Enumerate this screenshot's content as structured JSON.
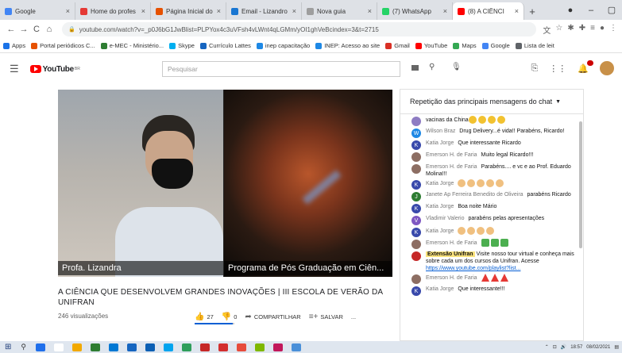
{
  "browser": {
    "tabs": [
      {
        "title": "Google",
        "favicon_color": "#4285f4"
      },
      {
        "title": "Home do profes",
        "favicon_color": "#e53935"
      },
      {
        "title": "Página Inicial do",
        "favicon_color": "#e65100"
      },
      {
        "title": "Email - Lizandro",
        "favicon_color": "#1976d2"
      },
      {
        "title": "Nova guia",
        "favicon_color": "#9e9e9e"
      },
      {
        "title": "(7) WhatsApp",
        "favicon_color": "#25d366"
      },
      {
        "title": "(8) A CIÊNCI",
        "favicon_color": "#ff0000"
      }
    ],
    "url": "youtube.com/watch?v=_p0J6bG1JwBlist=PLPYox4c3uVFsh4vLWnt4qLGMm/yOI1ghVeBcindex=3&t=2715",
    "bookmarks": [
      {
        "label": "Apps",
        "color": "#1a73e8"
      },
      {
        "label": "Portal periódicos C...",
        "color": "#e65100"
      },
      {
        "label": "e-MEC - Ministério...",
        "color": "#2e7d32"
      },
      {
        "label": "Skype",
        "color": "#00aff0"
      },
      {
        "label": "Currículo Lattes",
        "color": "#1565c0"
      },
      {
        "label": "inep capacitação",
        "color": "#1e88e5"
      },
      {
        "label": "INEP: Acesso ao site",
        "color": "#1e88e5"
      },
      {
        "label": "Gmail",
        "color": "#d93025"
      },
      {
        "label": "YouTube",
        "color": "#ff0000"
      },
      {
        "label": "Maps",
        "color": "#34a853"
      },
      {
        "label": "Google",
        "color": "#4285f4"
      },
      {
        "label": "Lista de leit",
        "color": "#5f6368"
      }
    ]
  },
  "youtube": {
    "logo_text": "YouTube",
    "logo_country": "BR",
    "search_placeholder": "Pesquisar",
    "video": {
      "label_left": "Profa. Lizandra",
      "label_right": "Programa de Pós Graduação em Ciên...",
      "title": "A CIÊNCIA QUE DESENVOLVEM GRANDES INOVAÇÕES | III ESCOLA DE VERÃO DA UNIFRAN",
      "views": "246 visualizações",
      "likes": "27",
      "dislikes": "0",
      "share_label": "COMPARTILHAR",
      "save_label": "SALVAR",
      "more_label": "...",
      "like_ratio": 0.96
    },
    "chat": {
      "header": "Repetição das principais mensagens do chat",
      "messages": [
        {
          "author": "",
          "text": "vacinas da China",
          "emojis": [
            "smile",
            "smile",
            "smile",
            "smile"
          ],
          "avatar_color": "#8e7cc3",
          "avatar_letter": ""
        },
        {
          "author": "Wilson Braz",
          "text": "Drug Delivery...é vida!! Parabéns, Ricardo!",
          "emojis": [],
          "avatar_color": "#1e88e5",
          "avatar_letter": "W"
        },
        {
          "author": "Katia Jorge",
          "text": "Que interessante Ricardo",
          "emojis": [],
          "avatar_color": "#3949ab",
          "avatar_letter": "K"
        },
        {
          "author": "Emerson H. de Faria",
          "text": "Muito legal Ricardo!!!",
          "emojis": [],
          "avatar_color": "#8d6e63",
          "avatar_letter": ""
        },
        {
          "author": "Emerson H. de Faria",
          "text": "Parabéns.... e vc e ao Prof. Eduardo Molina!!!",
          "emojis": [],
          "avatar_color": "#8d6e63",
          "avatar_letter": ""
        },
        {
          "author": "Katia Jorge",
          "text": "",
          "emojis": [
            "clap",
            "clap",
            "clap",
            "clap",
            "clap"
          ],
          "avatar_color": "#3949ab",
          "avatar_letter": "K"
        },
        {
          "author": "Janete Ap Ferreira Benedito de Oliveira",
          "text": "parabéns Ricardo",
          "emojis": [],
          "avatar_color": "#2e7d32",
          "avatar_letter": "J"
        },
        {
          "author": "Katia Jorge",
          "text": "Boa noite Mário",
          "emojis": [],
          "avatar_color": "#3949ab",
          "avatar_letter": "K"
        },
        {
          "author": "Vladimir Valerio",
          "text": "parabéns pelas apresentações",
          "emojis": [],
          "avatar_color": "#7e57c2",
          "avatar_letter": "V"
        },
        {
          "author": "Katia Jorge",
          "text": "",
          "emojis": [
            "clap",
            "clap",
            "clap",
            "clap"
          ],
          "avatar_color": "#3949ab",
          "avatar_letter": "K"
        },
        {
          "author": "Emerson H. de Faria",
          "text": "",
          "emojis": [
            "leaf",
            "leaf",
            "leaf"
          ],
          "avatar_color": "#8d6e63",
          "avatar_letter": ""
        },
        {
          "author": "Extensão Unifran",
          "text": "Visite nosso tour virtual e conheça mais sobre cada um dos cursos da Unifran. Acesse",
          "link": "https://www.youtube.com/playlist?list...",
          "paid": true,
          "emojis": [],
          "avatar_color": "#c62828",
          "avatar_letter": ""
        },
        {
          "author": "Emerson H. de Faria",
          "text": "",
          "emojis": [
            "cake",
            "cake",
            "cake"
          ],
          "avatar_color": "#8d6e63",
          "avatar_letter": ""
        },
        {
          "author": "Katia Jorge",
          "text": "Que interessante!!!",
          "emojis": [],
          "avatar_color": "#3949ab",
          "avatar_letter": "K"
        }
      ]
    }
  },
  "taskbar": {
    "apps": [
      "#1f6feb",
      "#ffffff",
      "#f2a900",
      "#2e7d32",
      "#0078d4",
      "#1565c0",
      "#0b5fb4",
      "#00a4ef",
      "#2e9e5b",
      "#c62828",
      "#d32f2f",
      "#e74c3c",
      "#7fb800",
      "#c2185b",
      "#4a90d9"
    ],
    "time": "18:57",
    "date": "08/02/2021"
  }
}
